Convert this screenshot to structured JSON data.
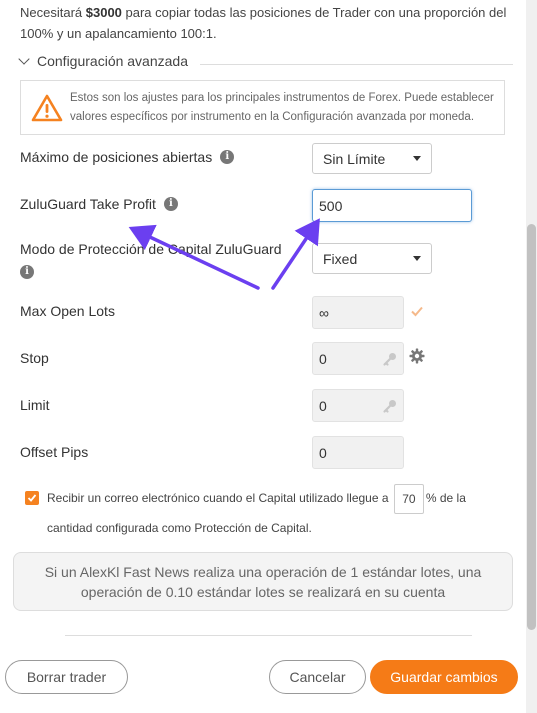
{
  "intro": {
    "prefix": "Necesitará ",
    "amount": "$3000",
    "suffix": " para copiar todas las posiciones de Trader con una proporción del 100% y un apalancamiento 100:1."
  },
  "section": {
    "title": "Configuración avanzada"
  },
  "warning": {
    "text": "Estos son los ajustes para los principales instrumentos de Forex. Puede establecer valores específicos por instrumento en la Configuración avanzada por moneda."
  },
  "fields": {
    "max_positions": {
      "label": "Máximo de posiciones abiertas",
      "value": "Sin Límite"
    },
    "take_profit": {
      "label": "ZuluGuard Take Profit",
      "value": "500"
    },
    "protection_mode": {
      "label": "Modo de Protección de Capital ZuluGuard",
      "value": "Fixed"
    },
    "max_open_lots": {
      "label": "Max Open Lots",
      "value": "∞"
    },
    "stop": {
      "label": "Stop",
      "value": "0"
    },
    "limit": {
      "label": "Limit",
      "value": "0"
    },
    "offset_pips": {
      "label": "Offset Pips",
      "value": "0"
    }
  },
  "email_option": {
    "text_before": "Recibir un correo electrónico cuando el Capital utilizado llegue a",
    "percent": "70",
    "text_after": "% de la cantidad configurada como Protección de Capital."
  },
  "notice": {
    "text": "Si un AlexKl Fast News realiza una operación de 1 estándar lotes, una operación de 0.10 estándar lotes se realizará en su cuenta"
  },
  "buttons": {
    "remove": "Borrar trader",
    "cancel": "Cancelar",
    "save": "Guardar cambios"
  },
  "colors": {
    "accent": "#f57b17",
    "annotation_arrow": "#6b3ff0",
    "focus": "#5b9bd5"
  }
}
